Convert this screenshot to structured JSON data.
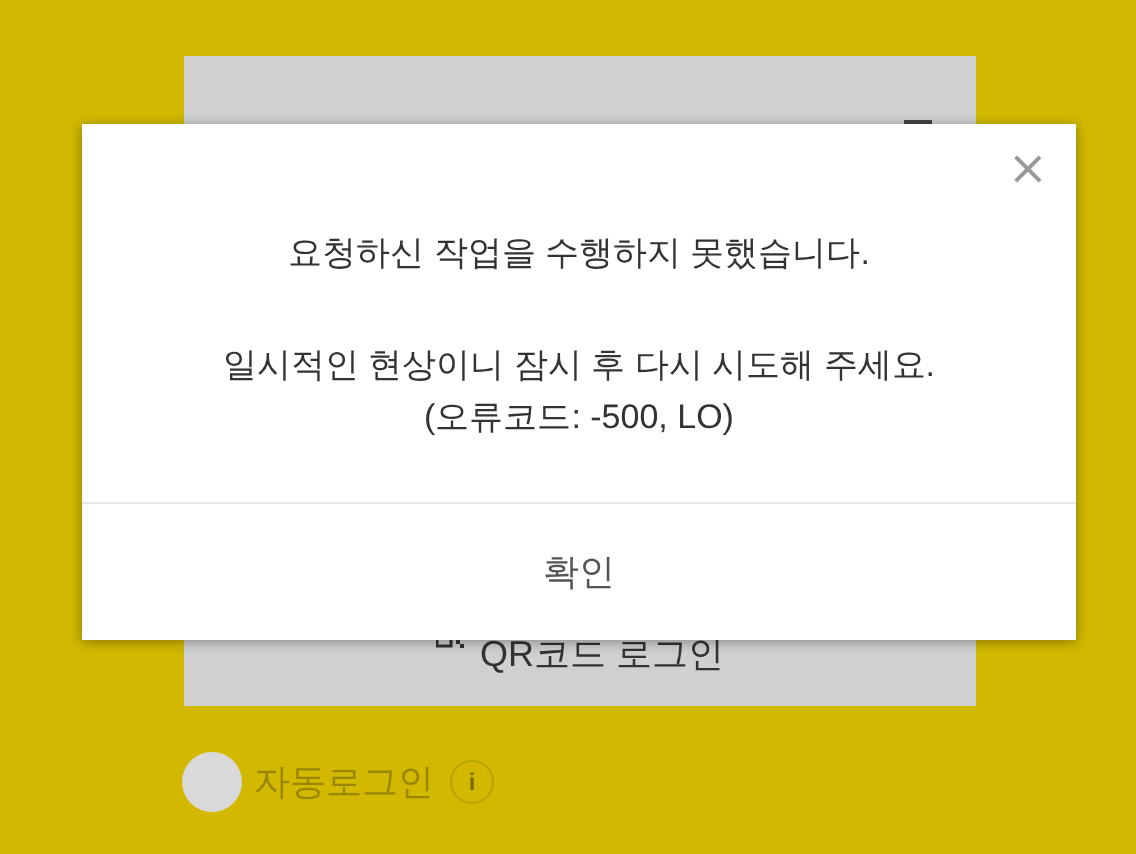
{
  "background": {
    "qr_login_button": "QR코드 로그인",
    "auto_login": {
      "label": "자동로그인",
      "checked": false,
      "info": "i"
    }
  },
  "dialog": {
    "close": "×",
    "message": "요청하신 작업을 수행하지 못했습니다.",
    "detail": "일시적인 현상이니 잠시 후 다시 시도해 주세요.",
    "error_code": "(오류코드: -500, LO)",
    "confirm": "확인"
  }
}
